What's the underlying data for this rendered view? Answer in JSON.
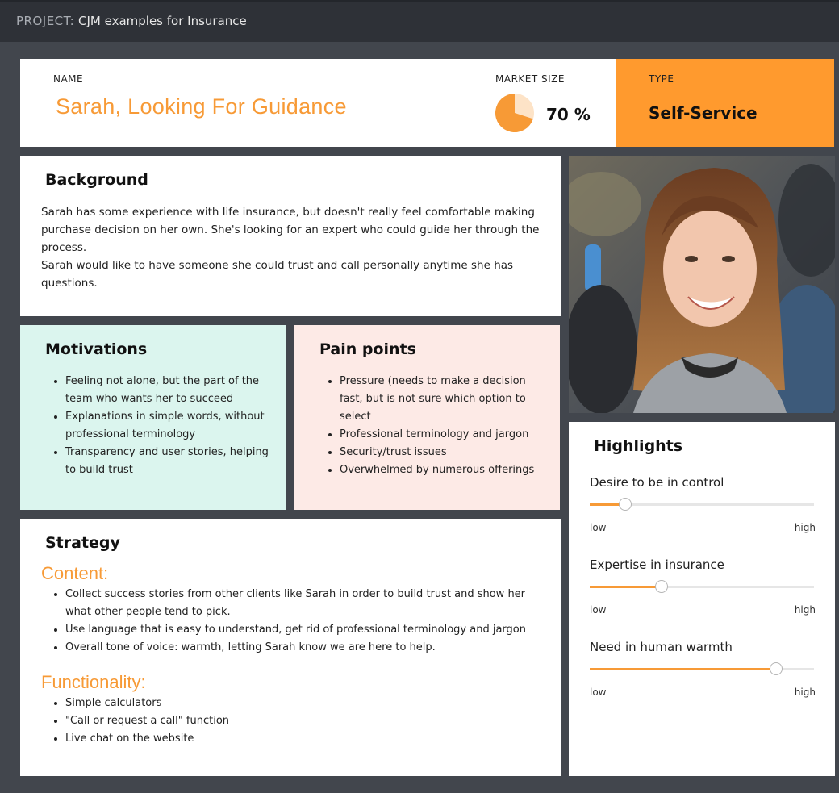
{
  "topbar": {
    "project_label": "PROJECT:",
    "project_name": "CJM examples for Insurance"
  },
  "header": {
    "name_label": "NAME",
    "name": "Sarah, Looking For Guidance",
    "market_size_label": "MARKET SIZE",
    "market_size_value": "70 %",
    "market_size_fraction": 0.7,
    "type_label": "TYPE",
    "type_value": "Self-Service"
  },
  "background": {
    "title": "Background",
    "paragraphs": [
      "Sarah has some experience with life insurance, but doesn't really feel comfortable making purchase decision on her own. She's looking for an expert who could guide her through the process.",
      "Sarah would like to have someone she could trust and call personally anytime she has questions."
    ]
  },
  "motivations": {
    "title": "Motivations",
    "items": [
      "Feeling not alone, but the part of the team who wants her to succeed",
      "Explanations in simple words, without professional terminology",
      "Transparency and user stories, helping to build trust"
    ]
  },
  "pain_points": {
    "title": "Pain points",
    "items": [
      "Pressure (needs to make a decision fast, but is not sure which option to select",
      "Professional terminology and jargon",
      "Security/trust issues",
      "Overwhelmed by numerous offerings"
    ]
  },
  "strategy": {
    "title": "Strategy",
    "content_heading": "Content:",
    "content_items": [
      "Collect success stories from other clients like Sarah in order to build trust and show her what other people tend to pick.",
      "Use language that is easy to understand, get rid of professional terminology and jargon",
      "Overall tone of voice: warmth, letting Sarah know we are here to help."
    ],
    "functionality_heading": "Functionality:",
    "functionality_items": [
      "Simple calculators",
      "\"Call or request a call\" function",
      "Live chat on the website"
    ]
  },
  "highlights": {
    "title": "Highlights",
    "items": [
      {
        "label": "Desire to be in control",
        "value": 0.16,
        "low": "low",
        "high": "high"
      },
      {
        "label": "Expertise in insurance",
        "value": 0.32,
        "low": "low",
        "high": "high"
      },
      {
        "label": "Need in human warmth",
        "value": 0.83,
        "low": "low",
        "high": "high"
      }
    ]
  },
  "colors": {
    "accent": "#f79a36",
    "type_bg": "#ff9a2e",
    "motivations_bg": "#dbf5ee",
    "pain_bg": "#fdeae6",
    "page_bg": "#42464d"
  }
}
